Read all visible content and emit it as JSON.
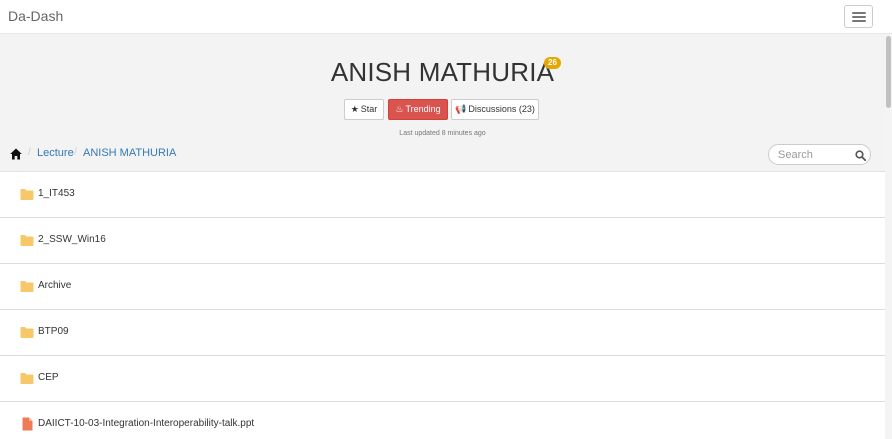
{
  "navbar": {
    "brand": "Da-Dash"
  },
  "header": {
    "title": "ANISH MATHURIA",
    "badge": "26",
    "buttons": {
      "star": "Star",
      "trending": "Trending",
      "discussions": "Discussions (23)"
    },
    "last_updated": "Last updated  8 minutes   ago"
  },
  "breadcrumb": {
    "items": [
      "Lecture",
      "ANISH MATHURIA"
    ]
  },
  "search": {
    "placeholder": "Search"
  },
  "files": [
    {
      "name": "1_IT453",
      "type": "folder"
    },
    {
      "name": "2_SSW_Win16",
      "type": "folder"
    },
    {
      "name": "Archive",
      "type": "folder"
    },
    {
      "name": "BTP09",
      "type": "folder"
    },
    {
      "name": "CEP",
      "type": "folder"
    },
    {
      "name": "DAIICT-10-03-Integration-Interoperability-talk.ppt",
      "type": "file"
    }
  ],
  "colors": {
    "folder": "#f6c86a",
    "file": "#ef7b56",
    "trending": "#d9534f",
    "badge": "#e5a800",
    "link": "#337ab7"
  }
}
